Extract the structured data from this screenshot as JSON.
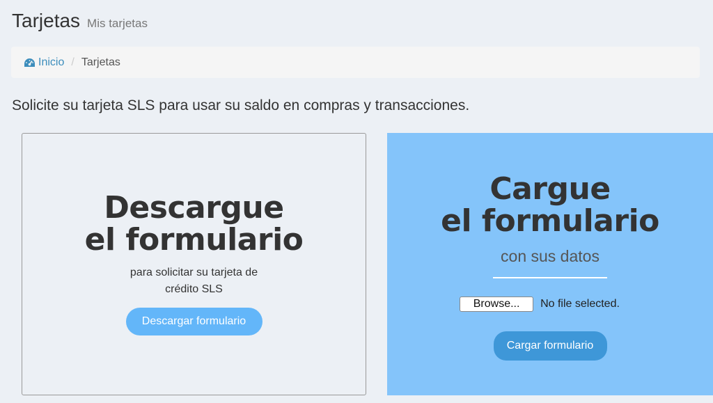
{
  "header": {
    "title": "Tarjetas",
    "subtitle": "Mis tarjetas"
  },
  "breadcrumb": {
    "home_label": "Inicio",
    "home_icon": "dashboard-icon",
    "separator": "/",
    "current": "Tarjetas"
  },
  "intro": "Solicite su tarjeta SLS para usar su saldo en compras y transacciones.",
  "download_card": {
    "title_line1": "Descargue",
    "title_line2": "el formulario",
    "text_line1": "para solicitar su tarjeta de",
    "text_line2": "crédito SLS",
    "button_label": "Descargar formulario"
  },
  "upload_card": {
    "title_line1": "Cargue",
    "title_line2": "el formulario",
    "subtitle": "con sus datos",
    "browse_label": "Browse...",
    "file_status": "No file selected.",
    "button_label": "Cargar formulario"
  },
  "colors": {
    "link": "#3c8dbc",
    "download_button": "#63b6f9",
    "upload_panel": "#84c4fa",
    "upload_button": "#3e97d8"
  }
}
